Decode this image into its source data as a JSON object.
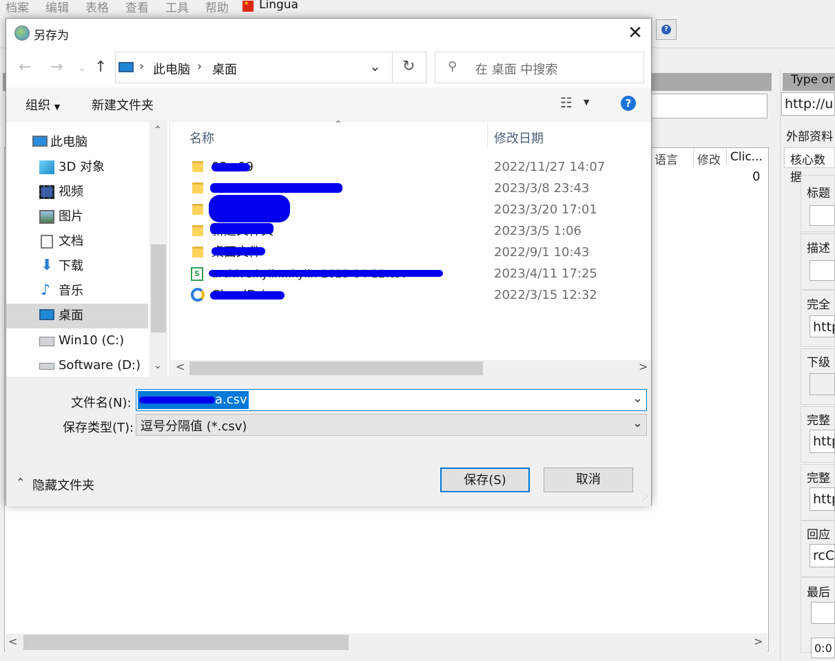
{
  "app": {
    "menu": [
      "档案",
      "编辑",
      "表格",
      "查看",
      "工具",
      "帮助"
    ],
    "lingua": "Lingua"
  },
  "left_pane": {
    "columns": [
      "语言",
      "修改",
      "Clic..."
    ],
    "count": "0"
  },
  "right_pane": {
    "header": "Type or",
    "url_value": "http://up",
    "section": "外部资料",
    "tab": "核心数据",
    "labels": [
      "标题",
      "描述",
      "完全",
      "下级",
      "完整",
      "完整",
      "回应",
      "最后"
    ],
    "values": [
      "http",
      "http",
      "http",
      "rcCo",
      "0:0"
    ]
  },
  "dialog": {
    "title": "另存为",
    "breadcrumb": [
      "此电脑",
      "桌面"
    ],
    "search_placeholder": "在 桌面 中搜索",
    "organize": "组织",
    "new_folder": "新建文件夹",
    "nav_items": [
      "此电脑",
      "3D 对象",
      "视频",
      "图片",
      "文档",
      "下载",
      "音乐",
      "桌面",
      "Win10 (C:)",
      "Software (D:)"
    ],
    "columns": {
      "name": "名称",
      "date": "修改日期"
    },
    "files": [
      {
        "name": "03~09",
        "date": "2022/11/27 14:07"
      },
      {
        "name": "",
        "date": "2023/3/8 23:43"
      },
      {
        "name": "",
        "date": "2023/3/20 17:01"
      },
      {
        "name": "新建文件夹",
        "date": "2023/3/5 1:06"
      },
      {
        "name": "桌面文件",
        "date": "2022/9/1 10:43"
      },
      {
        "name": "archive.kylin...kylin-2023-04-12.csv",
        "date": "2023/4/11 17:25"
      },
      {
        "name": "CloudDrive",
        "date": "2022/3/15 12:32"
      }
    ],
    "filename_label": "文件名(N):",
    "filename_value": "a.csv",
    "filetype_label": "保存类型(T):",
    "filetype_value": "逗号分隔值 (*.csv)",
    "hide_folders": "隐藏文件夹",
    "save": "保存(S)",
    "cancel": "取消"
  }
}
